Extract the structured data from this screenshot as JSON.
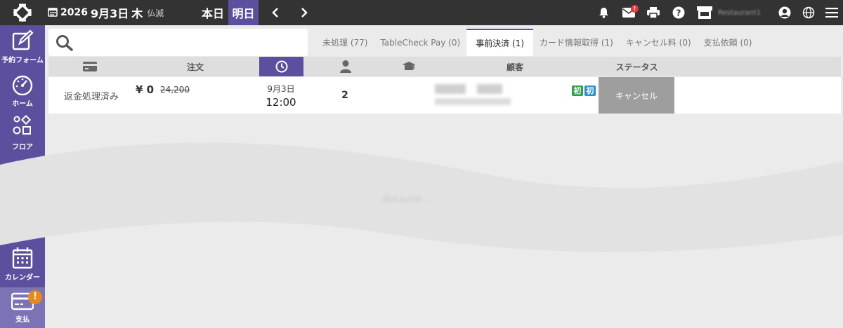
{
  "header": {
    "year": "2026",
    "month_day": "9月3日",
    "weekday": "木",
    "rokuyo": "仏滅",
    "today_label": "本日",
    "tomorrow_label": "明日",
    "mail_badge": "!",
    "store_name": "Restaurant1",
    "colors": {
      "bar": "#333333",
      "accent": "#5b4f9e",
      "badge": "#e53935"
    }
  },
  "sidebar": {
    "items": [
      {
        "label": "予約フォーム",
        "icon": "edit-icon"
      },
      {
        "label": "ホーム",
        "icon": "dashboard-icon"
      },
      {
        "label": "フロア",
        "icon": "floor-icon"
      },
      {
        "label": "カレンダー",
        "icon": "calendar-icon"
      },
      {
        "label": "支払",
        "icon": "credit-card-icon",
        "alert": "!"
      }
    ]
  },
  "search": {
    "placeholder": "",
    "value": ""
  },
  "tabs": [
    {
      "label": "未処理 (77)"
    },
    {
      "label": "TableCheck Pay (0)"
    },
    {
      "label": "事前決済 (1)"
    },
    {
      "label": "カード情報取得 (1)"
    },
    {
      "label": "キャンセル料 (0)"
    },
    {
      "label": "支払依頼 (0)"
    }
  ],
  "table": {
    "headers": {
      "order": "注文",
      "customer": "顧客",
      "status": "ステータス"
    },
    "rows": [
      {
        "payment_status": "返金処理済み",
        "amount": "¥ 0",
        "original_amount": "24,200",
        "date": "9月3日",
        "time": "12:00",
        "party_size": "2",
        "tag1": "初",
        "tag2": "初",
        "status": "キャンセル"
      }
    ]
  },
  "loading_text": "読み込み中..."
}
